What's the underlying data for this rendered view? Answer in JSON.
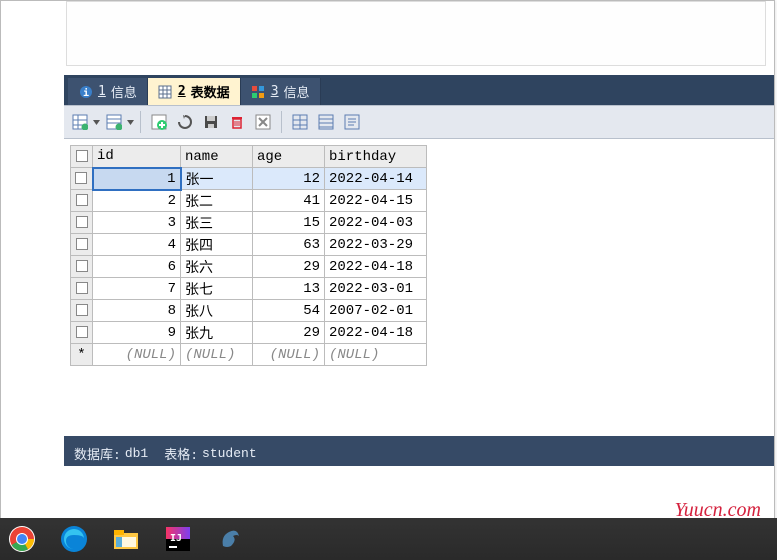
{
  "tabs": [
    {
      "num": "1",
      "label": "信息",
      "icon_color": "#3a7fc9"
    },
    {
      "num": "2",
      "label": "表数据",
      "icon_color": "#3a7fc9",
      "active": true
    },
    {
      "num": "3",
      "label": "信息",
      "icon_color": "#7a3ac9"
    }
  ],
  "columns": [
    {
      "key": "id",
      "label": "id"
    },
    {
      "key": "name",
      "label": "name"
    },
    {
      "key": "age",
      "label": "age"
    },
    {
      "key": "birthday",
      "label": "birthday"
    }
  ],
  "rows": [
    {
      "id": "1",
      "name": "张一",
      "age": "12",
      "birthday": "2022-04-14",
      "selected": true
    },
    {
      "id": "2",
      "name": "张二",
      "age": "41",
      "birthday": "2022-04-15"
    },
    {
      "id": "3",
      "name": "张三",
      "age": "15",
      "birthday": "2022-04-03"
    },
    {
      "id": "4",
      "name": "张四",
      "age": "63",
      "birthday": "2022-03-29"
    },
    {
      "id": "6",
      "name": "张六",
      "age": "29",
      "birthday": "2022-04-18"
    },
    {
      "id": "7",
      "name": "张七",
      "age": "13",
      "birthday": "2022-03-01"
    },
    {
      "id": "8",
      "name": "张八",
      "age": "54",
      "birthday": "2007-02-01"
    },
    {
      "id": "9",
      "name": "张九",
      "age": "29",
      "birthday": "2022-04-18"
    }
  ],
  "null_row": {
    "marker": "*",
    "value": "(NULL)"
  },
  "status": {
    "db_label": "数据库:",
    "db_value": "db1",
    "table_label": "表格:",
    "table_value": "student"
  },
  "watermark": "Yuucn.com"
}
